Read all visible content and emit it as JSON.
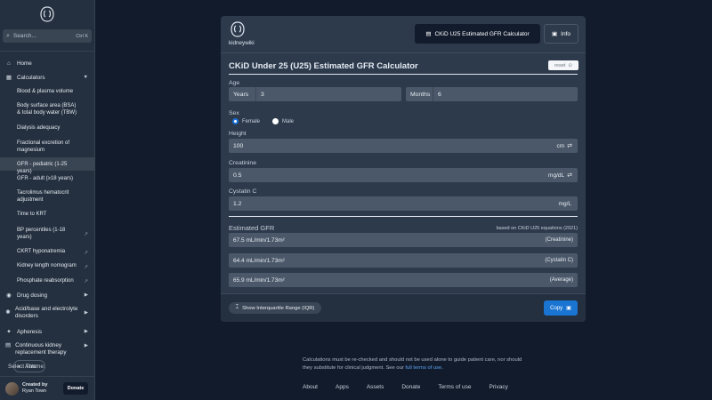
{
  "sidebar": {
    "search": {
      "placeholder": "Search...",
      "shortcut": "Ctrl K"
    },
    "items": [
      {
        "label": "Home",
        "icon": "home-icon"
      },
      {
        "label": "Calculators",
        "icon": "calculator-icon"
      }
    ],
    "calculators": [
      {
        "label": "Blood & plasma volume"
      },
      {
        "label": "Body surface area (BSA) & total body water (TBW)"
      },
      {
        "label": "Dialysis adequacy"
      },
      {
        "label": "Fractional excretion of magnesium"
      },
      {
        "label": "GFR - pediatric (1-25 years)"
      },
      {
        "label": "GFR - adult (≥18 years)"
      },
      {
        "label": "Tacrolimus hematocrit adjustment"
      },
      {
        "label": "Time to KRT"
      },
      {
        "label": "BP percentiles (1-18 years)"
      },
      {
        "label": "CKRT hyponatremia"
      },
      {
        "label": "Kidney length nomogram"
      },
      {
        "label": "Phosphate reabsorption"
      }
    ],
    "groups": [
      {
        "label": "Drug dosing",
        "icon": "pill-icon"
      },
      {
        "label": "Acid/base and electrolyte disorders",
        "icon": "atom-icon"
      },
      {
        "label": "Apheresis",
        "icon": "apheresis-icon"
      },
      {
        "label": "Continuous kidney replacement therapy",
        "icon": "filter-icon"
      }
    ],
    "theme": {
      "label": "Select Theme:",
      "value": "Auto"
    },
    "creator": {
      "line1": "Created by",
      "line2": "Ryan Town"
    },
    "donate": "Donate"
  },
  "card": {
    "brand": "kidneywiki",
    "header_button": "CKiD U25 Estimated GFR Calculator",
    "info_button": "Info",
    "title": "CKiD Under 25 (U25) Estimated GFR Calculator",
    "reset": "reset",
    "age": {
      "label": "Age",
      "years_prefix": "Years",
      "years_value": "3",
      "months_prefix": "Months",
      "months_value": "6"
    },
    "sex": {
      "label": "Sex",
      "female": "Female",
      "male": "Male",
      "selected": "Female"
    },
    "height": {
      "label": "Height",
      "value": "100",
      "unit": "cm"
    },
    "creatinine": {
      "label": "Creatinine",
      "value": "0.5",
      "unit": "mg/dL"
    },
    "cystatin": {
      "label": "Cystatin C",
      "value": "1.2",
      "unit": "mg/L"
    },
    "results": {
      "label": "Estimated GFR",
      "basis": "based on CKiD U25 equations (2021)",
      "rows": [
        {
          "value": "67.5 mL/min/1.73m²",
          "tag": "(Creatinine)"
        },
        {
          "value": "64.4 mL/min/1.73m²",
          "tag": "(Cystatin C)"
        },
        {
          "value": "65.9 mL/min/1.73m²",
          "tag": "(Average)"
        }
      ]
    },
    "iqr_button": "Show Interquartile Range (IQR)",
    "copy_button": "Copy"
  },
  "disclaimer": {
    "text": "Calculations must be re-checked and should not be used alone to guide patient care, nor should they substitute for clinical judgment. See our ",
    "link": "full terms of use",
    "end": "."
  },
  "footer": [
    "About",
    "Apps",
    "Assets",
    "Donate",
    "Terms of use",
    "Privacy"
  ]
}
